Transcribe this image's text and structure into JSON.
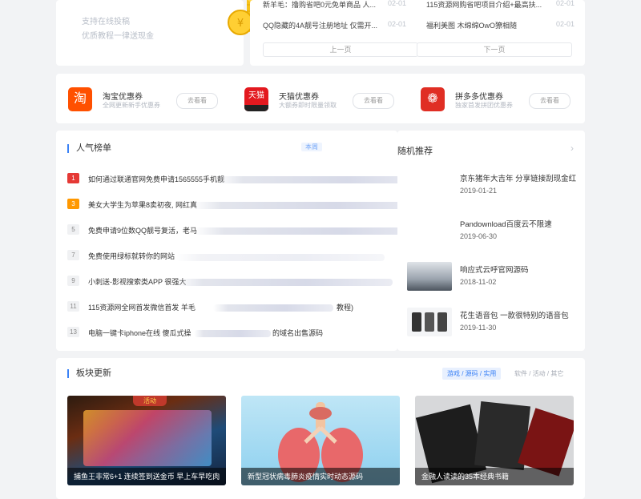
{
  "promo": {
    "line1": "支持在线投稿",
    "line2": "优质教程一律送现金"
  },
  "toplist": {
    "items": [
      {
        "text": "新羊毛：撸购省吧0元免单商品 人...",
        "date": "02-01"
      },
      {
        "text": "115资源网购省吧项目介绍+最高扶...",
        "date": "02-01"
      },
      {
        "text": "QQ隐藏的4A靓号注册地址 仅需开...",
        "date": "02-01"
      },
      {
        "text": "福利美图 木绵绵OwO獠相随",
        "date": "02-01"
      }
    ],
    "prev": "上一页",
    "next": "下一页"
  },
  "coupons": [
    {
      "logo_char": "淘",
      "title": "淘宝优惠券",
      "sub": "全网更新新手优惠券",
      "btn": "去看看",
      "color": "#ff5000"
    },
    {
      "logo_char": "天猫",
      "title": "天猫优惠券",
      "sub": "大额券即时限量领取",
      "btn": "去看看",
      "color": "#e3191f"
    },
    {
      "logo_char": "❁",
      "title": "拼多多优惠券",
      "sub": "独家首发拼团优惠券",
      "btn": "去看看",
      "color": "#e02e24"
    }
  ],
  "rank": {
    "title": "人气榜单",
    "tab": "本周",
    "rows": [
      {
        "num": "1",
        "text": "如何通过联通官网免费申请1565555手机靓",
        "color": "#e53935"
      },
      {
        "num": "3",
        "text": "美女大学生为苹果8卖初夜, 网红真",
        "color": "#ff9800"
      },
      {
        "num": "5",
        "text": "免费申请9位数QQ靓号复活，老马",
        "color": ""
      },
      {
        "num": "7",
        "text": "免费使用绿标就转你的网站",
        "color": ""
      },
      {
        "num": "9",
        "text": "小刺送-影视搜索类APP 很强大",
        "color": ""
      },
      {
        "num": "11",
        "text": "115资源网全网首发微信首发 羊毛",
        "tail": "教程)",
        "color": ""
      },
      {
        "num": "13",
        "text": "电脑一键卡iphone在线 傻瓜式操",
        "tail": "的域名出售源码",
        "color": ""
      }
    ]
  },
  "rec": {
    "title": "随机推荐",
    "items": [
      {
        "title": "京东猪年大吉年 分享链接刮现金红",
        "date": "2019-01-21"
      },
      {
        "title": "Pandownload百度云不限速",
        "date": "2019-06-30"
      },
      {
        "title": "响应式云呼官网源码",
        "date": "2018-11-02"
      },
      {
        "title": "花生语音包 一款很特别的语音包",
        "date": "2019-11-30"
      }
    ]
  },
  "blocks": {
    "title": "板块更新",
    "tab_active": "游戏 / 源码 / 实用",
    "tab_other": "软件 / 活动 / 其它",
    "tiles": [
      {
        "caption": "捕鱼王非常6+1 连续签到送金币 早上车早吃肉",
        "badge": "活动"
      },
      {
        "caption": "新型冠状病毒肺炎疫情实时动态源码"
      },
      {
        "caption": "金融人读读的35本经典书籍"
      }
    ]
  }
}
